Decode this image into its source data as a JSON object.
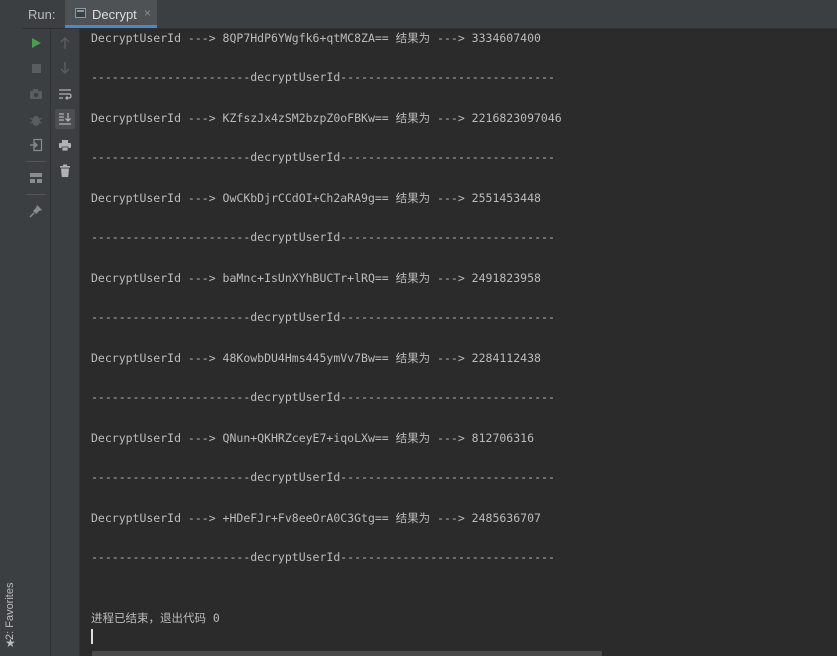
{
  "header": {
    "run_label": "Run:",
    "tab_label": "Decrypt",
    "tab_close": "×"
  },
  "sidebar": {
    "favorites_label": "2: Favorites",
    "favorites_star": "★"
  },
  "colors": {
    "run_green": "#499c54",
    "tab_underline": "#4a88c7",
    "icon_gray": "#8c8c8c"
  },
  "console": {
    "lines": [
      "DecryptUserId ---> 8QP7HdP6YWgfk6+qtMC8ZA== 结果为 ---> 3334607400",
      "-----------------------decryptUserId-------------------------------",
      "DecryptUserId ---> KZfszJx4zSM2bzpZ0oFBKw== 结果为 ---> 2216823097046",
      "-----------------------decryptUserId-------------------------------",
      "DecryptUserId ---> OwCKbDjrCCdOI+Ch2aRA9g== 结果为 ---> 2551453448",
      "-----------------------decryptUserId-------------------------------",
      "DecryptUserId ---> baMnc+IsUnXYhBUCTr+lRQ== 结果为 ---> 2491823958",
      "-----------------------decryptUserId-------------------------------",
      "DecryptUserId ---> 48KowbDU4Hms445ymVv7Bw== 结果为 ---> 2284112438",
      "-----------------------decryptUserId-------------------------------",
      "DecryptUserId ---> QNun+QKHRZceyE7+iqoLXw== 结果为 ---> 812706316",
      "-----------------------decryptUserId-------------------------------",
      "DecryptUserId ---> +HDeFJr+Fv8eeOrA0C3Gtg== 结果为 ---> 2485636707",
      "-----------------------decryptUserId-------------------------------",
      "进程已结束，退出代码 0"
    ]
  }
}
